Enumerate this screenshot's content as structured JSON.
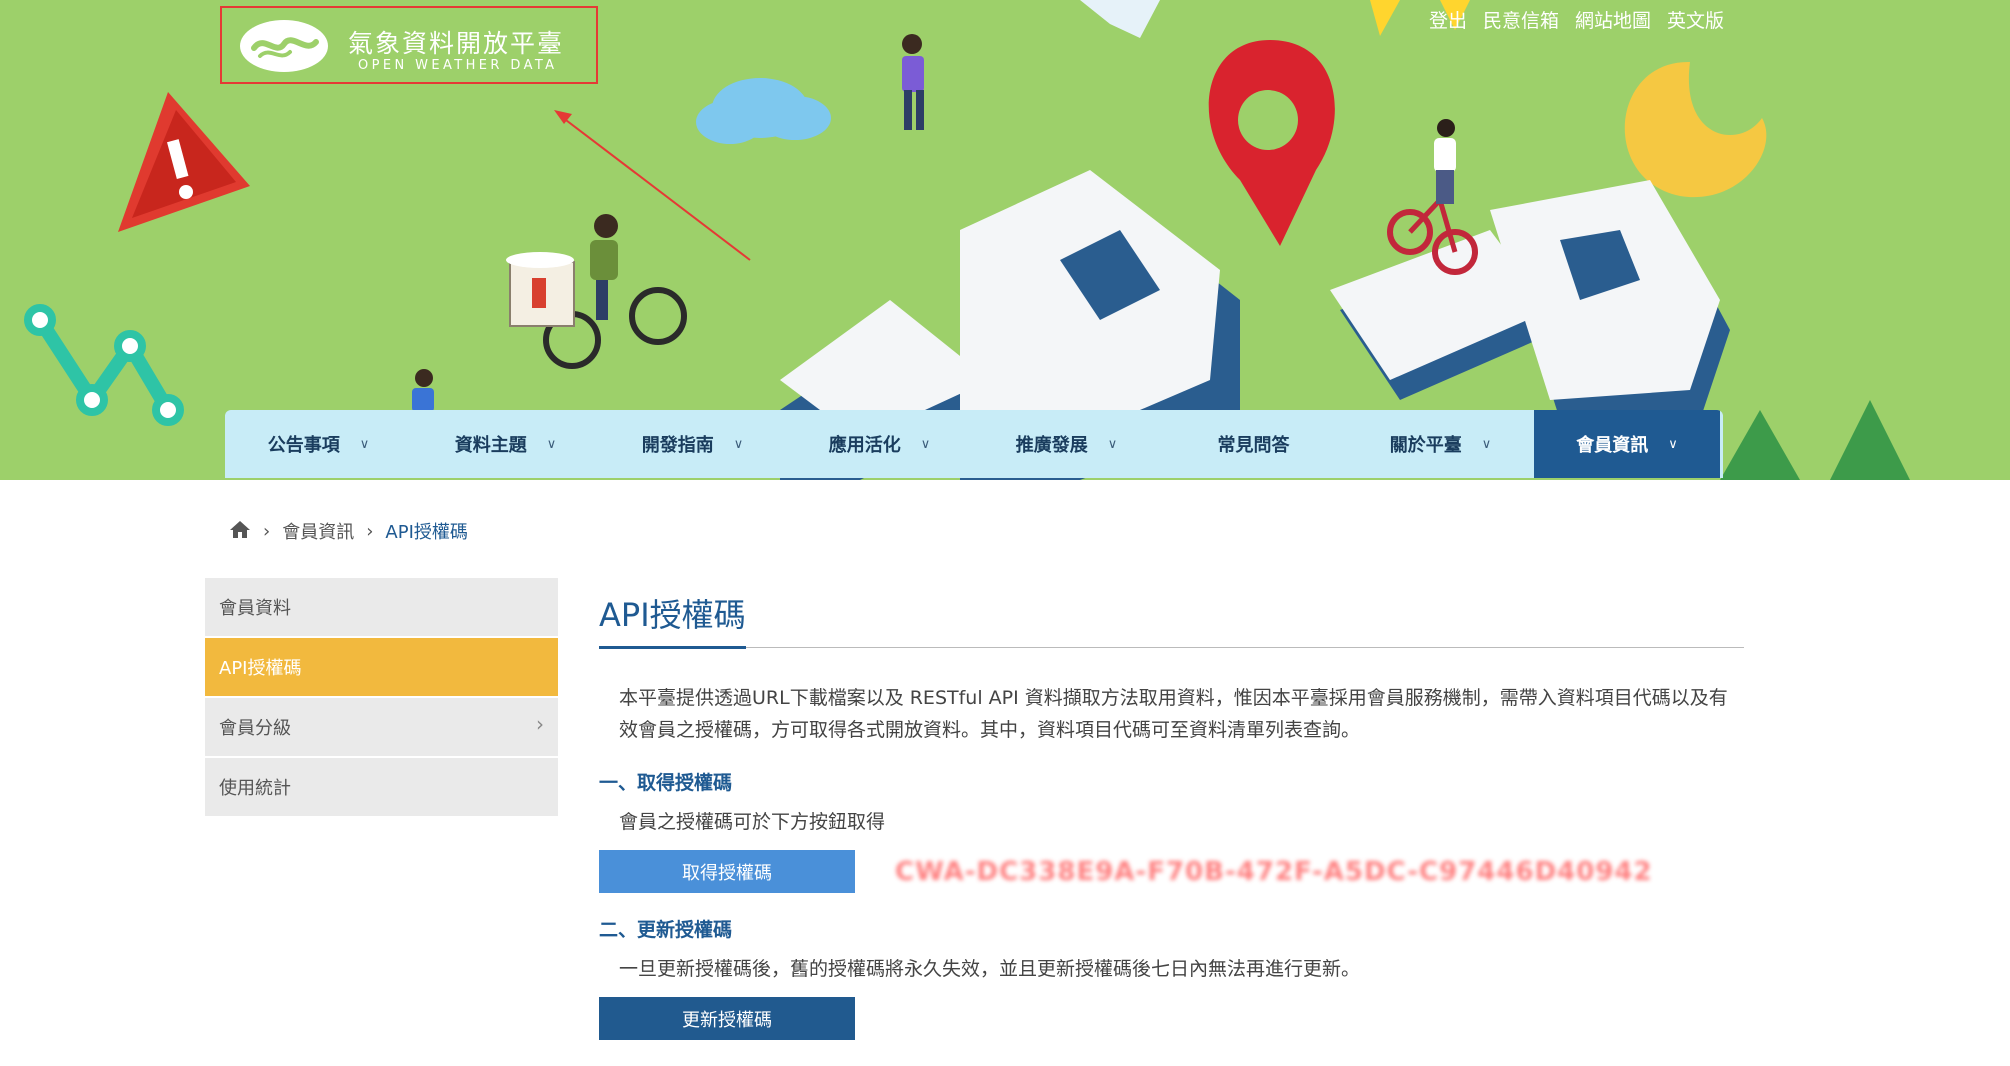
{
  "logo": {
    "title_cn": "氣象資料開放平臺",
    "title_en": "OPEN WEATHER DATA"
  },
  "top_links": [
    "登出",
    "民意信箱",
    "網站地圖",
    "英文版"
  ],
  "nav": [
    {
      "label": "公告事項",
      "dropdown": true
    },
    {
      "label": "資料主題",
      "dropdown": true
    },
    {
      "label": "開發指南",
      "dropdown": true
    },
    {
      "label": "應用活化",
      "dropdown": true
    },
    {
      "label": "推廣發展",
      "dropdown": true
    },
    {
      "label": "常見問答",
      "dropdown": false
    },
    {
      "label": "關於平臺",
      "dropdown": true
    },
    {
      "label": "會員資訊",
      "dropdown": true,
      "active": true
    }
  ],
  "breadcrumb": {
    "home_icon": "home-icon",
    "items": [
      "會員資訊",
      "API授權碼"
    ]
  },
  "sidebar": {
    "items": [
      {
        "label": "會員資料"
      },
      {
        "label": "API授權碼",
        "active": true
      },
      {
        "label": "會員分級",
        "has_children": true
      },
      {
        "label": "使用統計"
      }
    ]
  },
  "content": {
    "title": "API授權碼",
    "intro": "本平臺提供透過URL下載檔案以及 RESTful API 資料擷取方法取用資料，惟因本平臺採用會員服務機制，需帶入資料項目代碼以及有效會員之授權碼，方可取得各式開放資料。其中，資料項目代碼可至資料清單列表查詢。",
    "section1": {
      "heading": "一、取得授權碼",
      "text": "會員之授權碼可於下方按鈕取得",
      "button": "取得授權碼",
      "token": "CWA-DC338E9A-F70B-472F-A5DC-C97446D40942"
    },
    "section2": {
      "heading": "二、更新授權碼",
      "text": "一旦更新授權碼後，舊的授權碼將永久失效，並且更新授權碼後七日內無法再進行更新。",
      "button": "更新授權碼"
    }
  },
  "colors": {
    "banner_green": "#9dd06a",
    "nav_bg": "#c8ecf7",
    "nav_active": "#1f5a92",
    "sidebar_active": "#f2b93e",
    "button_primary": "#4a90d9",
    "button_dark": "#215a8f",
    "highlight_box": "#e53935"
  }
}
